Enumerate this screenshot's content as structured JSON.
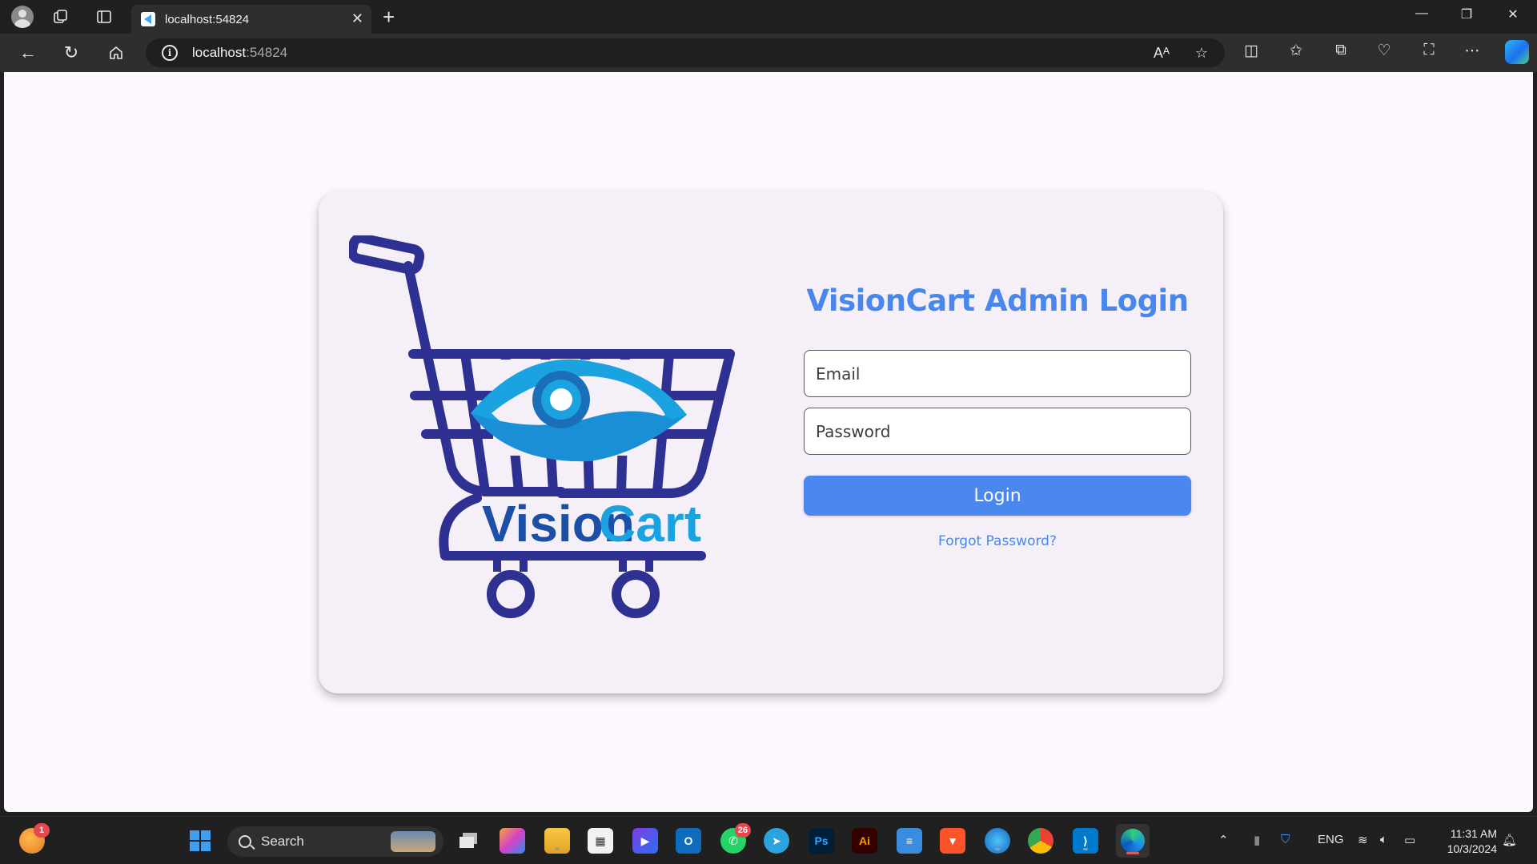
{
  "browser": {
    "tab": {
      "title": "localhost:54824"
    },
    "address": {
      "host": "localhost",
      "port": ":54824"
    }
  },
  "page": {
    "logo": {
      "brand_part1": "Vision",
      "brand_part2": "Cart"
    },
    "form": {
      "title": "VisionCart Admin Login",
      "email_placeholder": "Email",
      "password_placeholder": "Password",
      "login_label": "Login",
      "forgot_label": "Forgot Password?"
    },
    "colors": {
      "accent": "#4a87ee",
      "cart": "#2e3192",
      "eye": "#1aa3e0",
      "background": "#fdf7fe",
      "card": "#f5f0f7"
    }
  },
  "taskbar": {
    "search_label": "Search",
    "widgets_badge": "1",
    "whatsapp_badge": "26",
    "language": "ENG",
    "time": "11:31 AM",
    "date": "10/3/2024",
    "apps": [
      "widgets-icon",
      "start-icon",
      "search-box",
      "task-view-icon",
      "copilot-icon",
      "file-explorer-icon",
      "store-icon",
      "bing-icon",
      "outlook-icon",
      "whatsapp-icon",
      "telegram-icon",
      "photoshop-icon",
      "illustrator-icon",
      "notepad-icon",
      "brave-icon",
      "edge-dev-icon",
      "chrome-icon",
      "vscode-icon",
      "edge-icon"
    ],
    "app_labels": {
      "photoshop": "Ps",
      "illustrator": "Ai"
    }
  }
}
